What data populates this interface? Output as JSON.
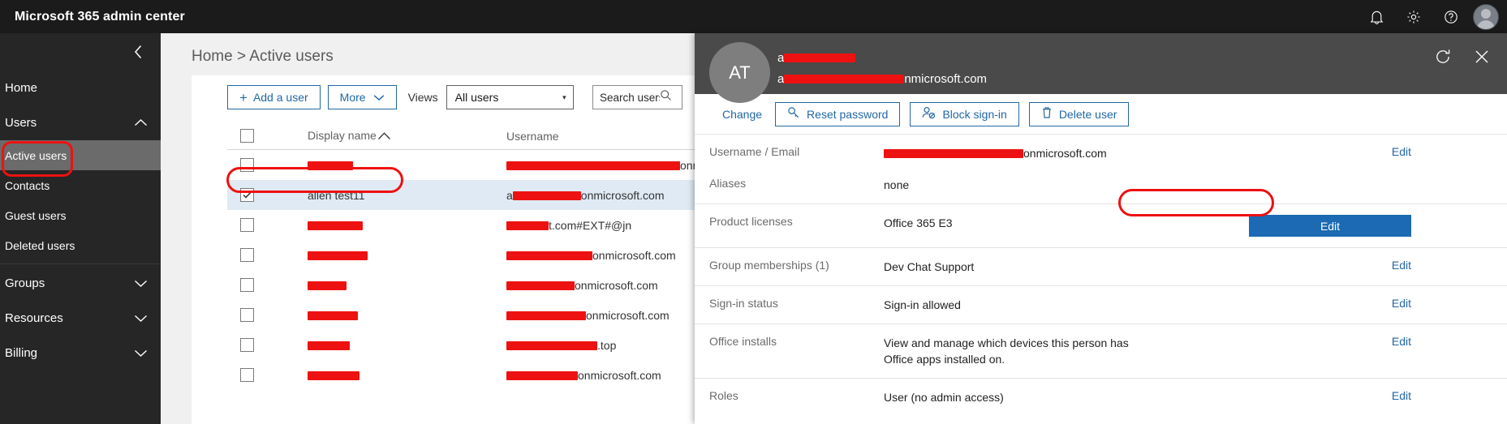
{
  "suitebar": {
    "title": "Microsoft 365 admin center",
    "icons": [
      "notification-bell-icon",
      "gear-icon",
      "help-icon",
      "account-avatar"
    ]
  },
  "leftnav": {
    "collapse_icon": "chevron-left-icon",
    "items": [
      {
        "label": "Home",
        "type": "link"
      },
      {
        "label": "Users",
        "type": "group",
        "expanded": true,
        "chevron": "chevron-up-icon"
      }
    ],
    "users_children": [
      {
        "label": "Active users",
        "selected": true
      },
      {
        "label": "Contacts",
        "selected": false
      },
      {
        "label": "Guest users",
        "selected": false
      },
      {
        "label": "Deleted users",
        "selected": false
      }
    ],
    "groups": [
      {
        "label": "Groups",
        "chevron": "chevron-down-icon"
      },
      {
        "label": "Resources",
        "chevron": "chevron-down-icon"
      },
      {
        "label": "Billing",
        "chevron": "chevron-down-icon"
      }
    ]
  },
  "main": {
    "breadcrumb": "Home > Active users",
    "toolbar": {
      "add_user_label": "Add a user",
      "add_user_plus": "+",
      "more_label": "More",
      "more_caret": "chevron-down-icon",
      "views_label": "Views",
      "view_selected": "All users",
      "view_caret": "▾"
    },
    "search": {
      "placeholder": "Search users",
      "value": "",
      "icon": "search-icon"
    },
    "table": {
      "columns": [
        "Display name",
        "Username"
      ],
      "sort_column": "Display name",
      "sort_direction": "ascending",
      "rows": [
        {
          "display_name": "",
          "display_redacted_w": 56,
          "username": "onmicrosoft.com",
          "username_prefix_visible": "",
          "username_redacted_w": 214,
          "checked": false,
          "selected": false
        },
        {
          "display_name": "allen test11",
          "display_redacted_w": 0,
          "username": "onmicrosoft.com",
          "username_prefix_visible": "a",
          "username_redacted_w": 84,
          "checked": true,
          "selected": true
        },
        {
          "display_name": "",
          "display_redacted_w": 68,
          "username": "t.com#EXT#@jn",
          "username_prefix_visible": "",
          "username_redacted_w": 52,
          "checked": false,
          "selected": false
        },
        {
          "display_name": "",
          "display_redacted_w": 74,
          "username": "onmicrosoft.com",
          "username_prefix_visible": "",
          "username_redacted_w": 106,
          "checked": false,
          "selected": false
        },
        {
          "display_name": "",
          "display_redacted_w": 48,
          "username": "onmicrosoft.com",
          "username_prefix_visible": "",
          "username_redacted_w": 84,
          "checked": false,
          "selected": false
        },
        {
          "display_name": "",
          "display_redacted_w": 62,
          "username": "onmicrosoft.com",
          "username_prefix_visible": "",
          "username_redacted_w": 98,
          "checked": false,
          "selected": false
        },
        {
          "display_name": "",
          "display_redacted_w": 52,
          "username": ".top",
          "username_prefix_visible": "",
          "username_redacted_w": 112,
          "checked": false,
          "selected": false
        },
        {
          "display_name": "",
          "display_redacted_w": 64,
          "username": "onmicrosoft.com",
          "username_prefix_visible": "",
          "username_redacted_w": 88,
          "checked": false,
          "selected": false
        }
      ]
    }
  },
  "panel": {
    "avatar_initials": "AT",
    "name_redacted": true,
    "name_visible_prefix": "a",
    "name_redacted_w": 88,
    "email_visible_prefix": "a",
    "email_redacted_w": 148,
    "email_suffix": "nmicrosoft.com",
    "header_icons": [
      "refresh-icon",
      "close-icon"
    ],
    "actions": [
      {
        "label": "Change",
        "style": "link",
        "icon": null
      },
      {
        "label": "Reset password",
        "style": "outline",
        "icon": "key-icon"
      },
      {
        "label": "Block sign-in",
        "style": "outline",
        "icon": "block-user-icon"
      },
      {
        "label": "Delete user",
        "style": "outline",
        "icon": "trash-icon"
      }
    ],
    "details": [
      {
        "label": "Username / Email",
        "value_prefix": "",
        "value_redacted_w": 172,
        "value": "onmicrosoft.com",
        "edit": "Edit",
        "edit_style": "link"
      },
      {
        "label": "Aliases",
        "value_prefix": "",
        "value_redacted_w": 0,
        "value": "none",
        "edit": null,
        "edit_style": "none"
      },
      {
        "label": "Product licenses",
        "value_prefix": "",
        "value_redacted_w": 0,
        "value": "Office 365 E3",
        "edit": "Edit",
        "edit_style": "primary"
      },
      {
        "label": "Group memberships (1)",
        "value_prefix": "",
        "value_redacted_w": 0,
        "value": "Dev Chat Support",
        "edit": "Edit",
        "edit_style": "link"
      },
      {
        "label": "Sign-in status",
        "value_prefix": "",
        "value_redacted_w": 0,
        "value": "Sign-in allowed",
        "edit": "Edit",
        "edit_style": "link"
      },
      {
        "label": "Office installs",
        "value_prefix": "",
        "value_redacted_w": 0,
        "value": "View and manage which devices this person has Office apps installed on.",
        "edit": "Edit",
        "edit_style": "link"
      },
      {
        "label": "Roles",
        "value_prefix": "",
        "value_redacted_w": 0,
        "value": "User (no admin access)",
        "edit": "Edit",
        "edit_style": "link"
      }
    ]
  },
  "annotations": {
    "color": "#ee1111",
    "shapes": [
      {
        "name": "active-users-nav-circle",
        "target": "Active users"
      },
      {
        "name": "selected-row-circle",
        "target": "allen test11"
      },
      {
        "name": "product-license-edit-circle",
        "target": "Edit"
      }
    ]
  }
}
